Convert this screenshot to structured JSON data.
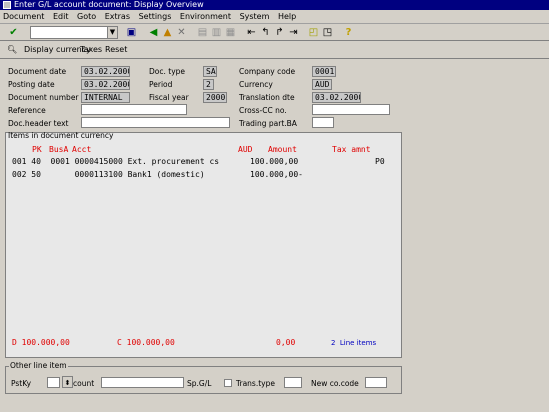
{
  "window": {
    "title": "Enter G/L account document: Display Overview"
  },
  "menu": [
    "Document",
    "Edit",
    "Goto",
    "Extras",
    "Settings",
    "Environment",
    "System",
    "Help"
  ],
  "appbar": {
    "display_currency": "Display currency",
    "taxes": "Taxes",
    "reset": "Reset"
  },
  "header": {
    "document_date_label": "Document date",
    "document_date": "03.02.2000",
    "doc_type_label": "Doc. type",
    "doc_type": "SA",
    "company_code_label": "Company code",
    "company_code": "0001",
    "posting_date_label": "Posting date",
    "posting_date": "03.02.2000",
    "period_label": "Period",
    "period": "2",
    "currency_label": "Currency",
    "currency": "AUD",
    "document_number_label": "Document number",
    "document_number": "INTERNAL",
    "fiscal_year_label": "Fiscal year",
    "fiscal_year": "2000",
    "translation_dte_label": "Translation dte",
    "translation_dte": "03.02.2000",
    "reference_label": "Reference",
    "reference": "",
    "cross_cc_label": "Cross-CC no.",
    "cross_cc": "",
    "doc_header_text_label": "Doc.header text",
    "doc_header_text": "",
    "trading_part_label": "Trading part.BA",
    "trading_part": ""
  },
  "items": {
    "title": "Items in document currency",
    "columns": {
      "pk": "PK",
      "busa": "BusA",
      "acct": "Acct",
      "aud": "AUD",
      "amount": "Amount",
      "tax_amnt": "Tax amnt"
    },
    "rows": [
      {
        "line": "001 40  0001 0000415000 Ext. procurement cs",
        "amount": "100.000,00",
        "tax": "P0"
      },
      {
        "line": "002 50       0000113100 Bank1 (domestic)",
        "amount": "100.000,00-",
        "tax": ""
      }
    ],
    "debit": "D 100.000,00",
    "credit": "C 100.000,00",
    "balance": "0,00",
    "line_items": "2  Line items"
  },
  "other_line_item": {
    "title": "Other line item",
    "pstky_label": "PstKy",
    "pstky": "",
    "account_label": "count",
    "account": "",
    "spgl_label": "Sp.G/L",
    "trans_type_label": "Trans.type",
    "new_co_code_label": "New co.code",
    "new_co_code": ""
  }
}
